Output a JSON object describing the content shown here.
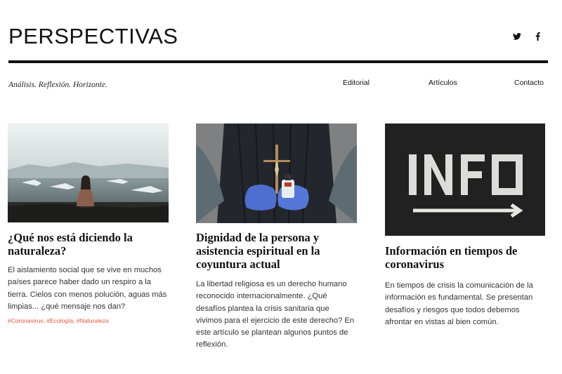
{
  "site": {
    "title": "PERSPECTIVAS",
    "tagline": "Análisis. Reflexión. Horizonte.",
    "social": [
      "twitter-icon",
      "facebook-icon"
    ]
  },
  "nav": {
    "items": [
      {
        "label": "Editorial"
      },
      {
        "label": "Artículos"
      },
      {
        "label": "Contacto"
      }
    ]
  },
  "articles": [
    {
      "title": "¿Qué nos está diciendo la naturaleza?",
      "excerpt": "El aislamiento social que se vive en muchos países parece haber dado un respiro a la tierra. Cielos con menos polución, aguas más limpias... ¿qué mensaje nos dan?",
      "tags": [
        "#Coronavirus",
        "#Ecología",
        "#Naturaleza"
      ],
      "image": "woman-sitting-by-icy-lake"
    },
    {
      "title": "Dignidad de la persona y asistencia espiritual en la coyuntura actual",
      "excerpt": "La libertad religiosa es un derecho humano reconocido internacionalmente. ¿Qué desafíos plantea la crisis sanitaria que vivimos para el ejercicio de este derecho? En este artículo se plantean algunos puntos de reflexión.",
      "tags": [],
      "image": "gloved-hands-holding-crucifix"
    },
    {
      "title": "Información en tiempos de coronavirus",
      "excerpt": "En tiempos de crisis la comunicación de la información es fundamental. Se presentan desafíos y riesgos que todos debemos afrontar en vistas al bien común.",
      "tags": [],
      "image": "info-chalk-on-blackboard"
    }
  ],
  "colors": {
    "tag": "#e8553f",
    "text": "#111111",
    "rule": "#111111"
  }
}
